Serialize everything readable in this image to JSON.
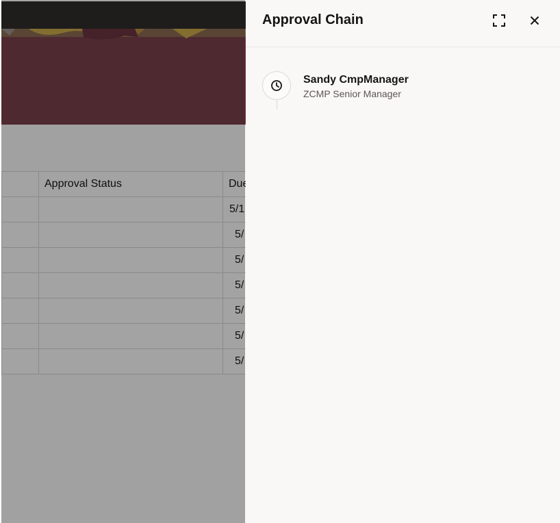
{
  "background_table": {
    "headers": [
      "",
      "Approval Status",
      "Due"
    ],
    "rows": [
      {
        "date": "5/1",
        "indent": false
      },
      {
        "date": "5/",
        "indent": true
      },
      {
        "date": "5/",
        "indent": true
      },
      {
        "date": "5/",
        "indent": true
      },
      {
        "date": "5/",
        "indent": true
      },
      {
        "date": "5/",
        "indent": true
      },
      {
        "date": "5/",
        "indent": true
      }
    ]
  },
  "drawer": {
    "title": "Approval Chain",
    "expand_icon": "expand-icon",
    "close_icon": "close-icon",
    "approvers": [
      {
        "name": "Sandy CmpManager",
        "role": "ZCMP Senior Manager",
        "status_icon": "clock-icon"
      }
    ]
  },
  "colors": {
    "topbar": "#312d2a",
    "banner": "#7a3f4a",
    "drawer_bg": "#f9f8f7",
    "text_primary": "#161513",
    "text_secondary": "#5b5652"
  }
}
